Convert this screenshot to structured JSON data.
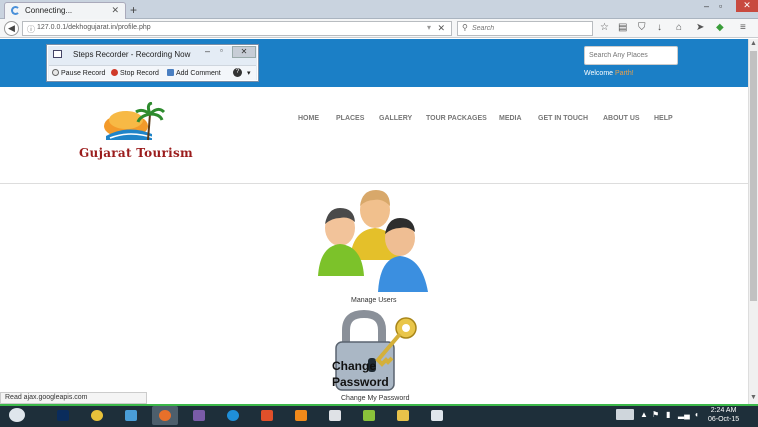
{
  "browser": {
    "tab_title": "Connecting...",
    "url": "127.0.0.1/dekhogujarat.in/profile.php",
    "search_placeholder": "Search"
  },
  "recorder": {
    "title": "Steps Recorder - Recording Now",
    "pause": "Pause Record",
    "stop": "Stop Record",
    "comment": "Add Comment",
    "help": "?"
  },
  "site": {
    "search_placeholder": "Search Any Places",
    "welcome_label": "Welcome",
    "welcome_name": "Parth!",
    "logo_text": "Gujarat Tourism",
    "menu": [
      "HOME",
      "PLACES",
      "GALLERY",
      "TOUR PACKAGES",
      "MEDIA",
      "GET IN TOUCH",
      "ABOUT US",
      "HELP"
    ],
    "manage_users_label": "Manage Users",
    "change_password_label": "Change My Password",
    "change_password_icon_text_1": "Change",
    "change_password_icon_text_2": "Password"
  },
  "status_text": "Read ajax.googleapis.com",
  "clock": {
    "time": "2:24 AM",
    "date": "06-Oct-15"
  },
  "colors": {
    "topbar": "#1b7fc6",
    "taskbar": "#1e2f3a",
    "taskbar_accent": "#3cb84a",
    "logo_text": "#9b1c1c"
  }
}
